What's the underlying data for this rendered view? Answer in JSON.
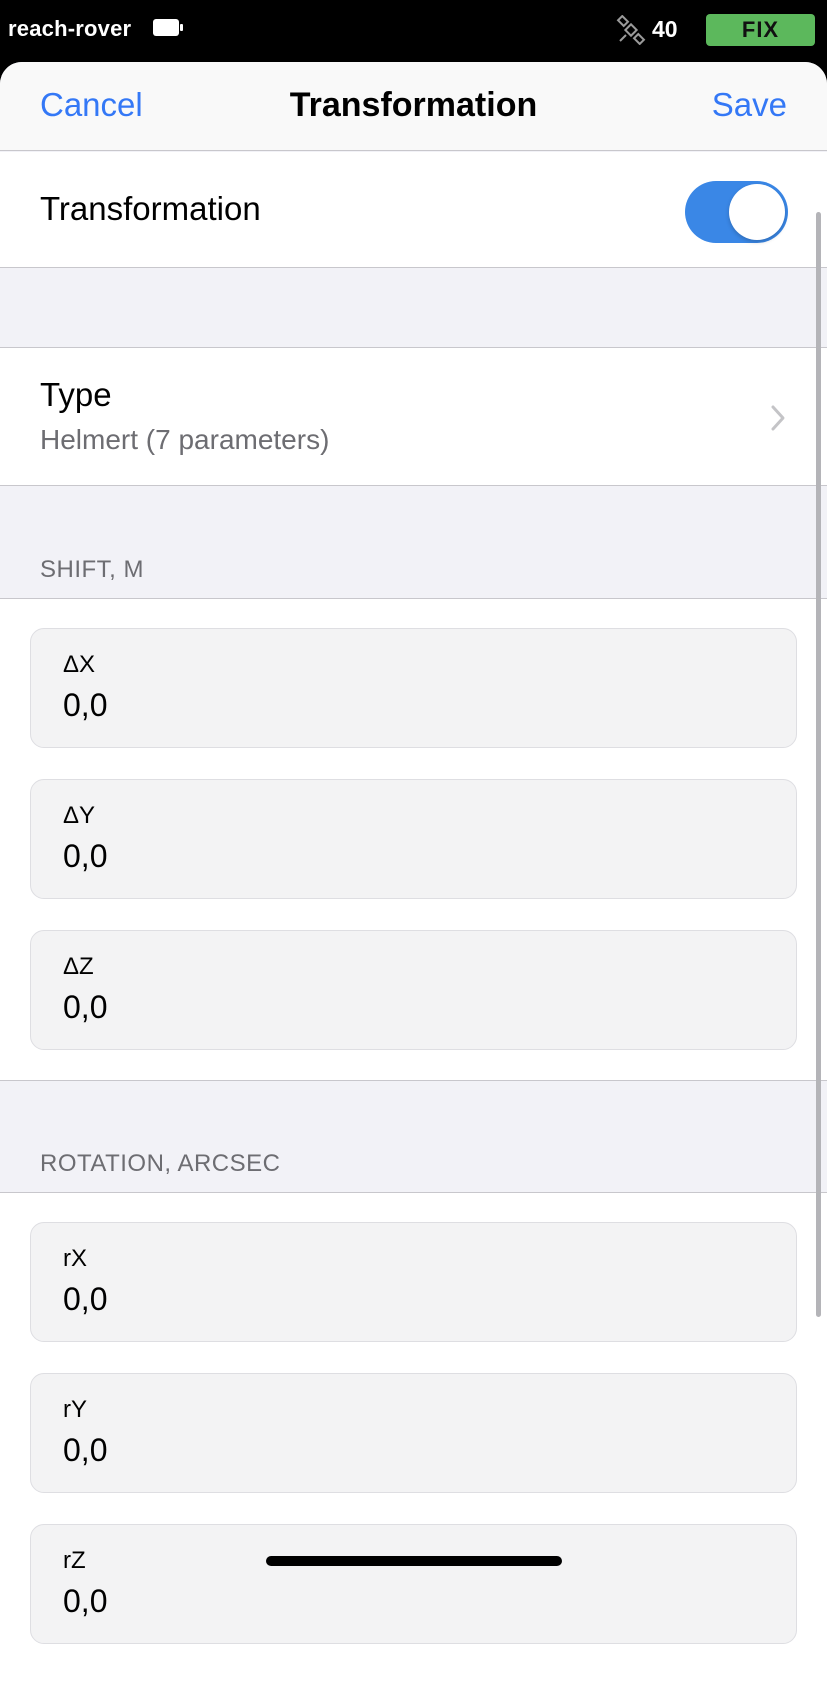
{
  "status_bar": {
    "device_name": "reach-rover",
    "satellite_count": "40",
    "fix_label": "FIX",
    "fix_color": "#5cb85c"
  },
  "nav": {
    "cancel_label": "Cancel",
    "title": "Transformation",
    "save_label": "Save",
    "accent_color": "#3478f6"
  },
  "transformation_toggle": {
    "label": "Transformation",
    "enabled": true
  },
  "type_row": {
    "label": "Type",
    "value": "Helmert (7 parameters)"
  },
  "shift_section": {
    "header": "SHIFT, M",
    "fields": [
      {
        "label": "ΔX",
        "value": "0,0"
      },
      {
        "label": "ΔY",
        "value": "0,0"
      },
      {
        "label": "ΔZ",
        "value": "0,0"
      }
    ]
  },
  "rotation_section": {
    "header": "ROTATION, ARCSEC",
    "fields": [
      {
        "label": "rX",
        "value": "0,0"
      },
      {
        "label": "rY",
        "value": "0,0"
      },
      {
        "label": "rZ",
        "value": "0,0"
      }
    ]
  },
  "icons": [
    "battery-icon",
    "satellite-icon",
    "chevron-right-icon"
  ]
}
